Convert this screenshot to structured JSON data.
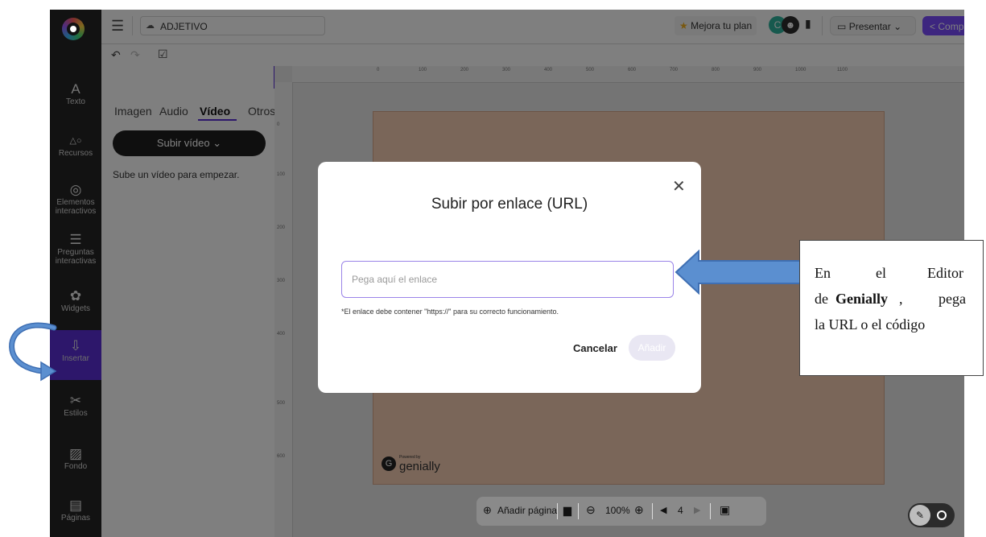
{
  "app": {
    "project_name": "ADJETIVO",
    "upgrade_label": "Mejora tu plan",
    "collaborator_initial": "C",
    "present_label": "Presentar",
    "share_label": "Compartir"
  },
  "sidebar": {
    "items": [
      {
        "label": "Texto",
        "icon": "A"
      },
      {
        "label": "Recursos",
        "icon": "△○"
      },
      {
        "label": "Elementos interactivos",
        "label_line1": "Elementos",
        "label_line2": "interactivos",
        "icon": "◎"
      },
      {
        "label": "Preguntas interactivas",
        "label_line1": "Preguntas",
        "label_line2": "interactivas",
        "icon": "☰"
      },
      {
        "label": "Widgets",
        "icon": "✿"
      },
      {
        "label": "Insertar",
        "icon": "⇩"
      },
      {
        "label": "Estilos",
        "icon": "✂"
      },
      {
        "label": "Fondo",
        "icon": "▨"
      },
      {
        "label": "Páginas",
        "icon": "▤"
      }
    ]
  },
  "panel": {
    "tabs": [
      "Imagen",
      "Audio",
      "Vídeo",
      "Otros"
    ],
    "active_tab": "Vídeo",
    "upload_button": "Subir vídeo",
    "hint": "Sube un vídeo para empezar."
  },
  "ruler": {
    "top_labels": [
      "0",
      "100",
      "200",
      "300",
      "400",
      "500",
      "600",
      "700",
      "800",
      "900",
      "1000",
      "1100"
    ],
    "left_labels": [
      "0",
      "100",
      "200",
      "300",
      "400",
      "500",
      "600"
    ]
  },
  "slide": {
    "badge_small": "Powered by",
    "badge_brand": "genially"
  },
  "modal": {
    "title": "Subir por enlace (URL)",
    "input_placeholder": "Pega aquí el enlace",
    "helper_text": "*El enlace debe contener \"https://\" para su correcto funcionamiento.",
    "cancel_label": "Cancelar",
    "add_label": "Añadir"
  },
  "bottombar": {
    "add_page_label": "Añadir página",
    "zoom": "100%",
    "page_number": "4"
  },
  "annotation": {
    "line1_a": "En",
    "line1_b": "el",
    "line1_c": "Editor",
    "line2_a": "de",
    "line2_bold": "Genially",
    "line2_b": ",",
    "line2_c": "pega",
    "line3": "la URL o el código"
  },
  "colors": {
    "accent": "#5b2fd6",
    "share_button": "#7b4dff",
    "slide_bg": "#f4cdb3",
    "annotation_arrow": "#5b8fd0"
  }
}
